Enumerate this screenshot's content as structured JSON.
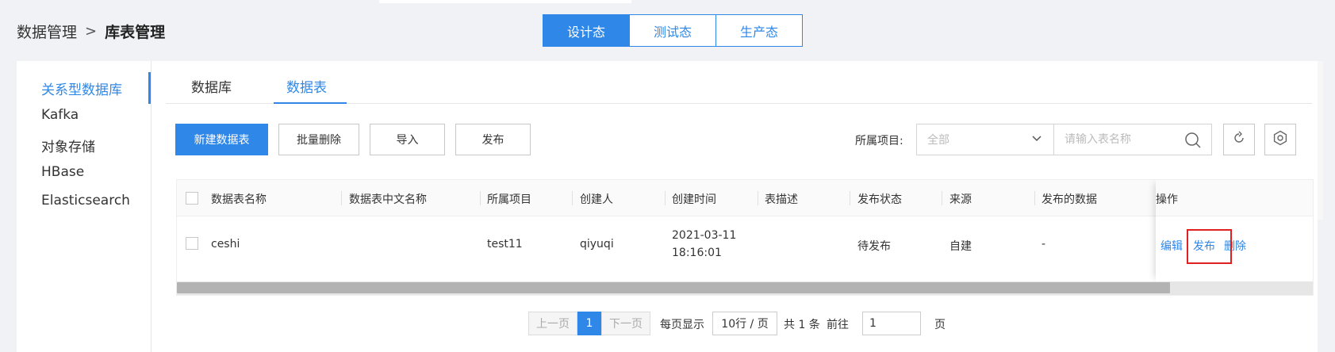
{
  "breadcrumb": {
    "parent": "数据管理",
    "separator": ">",
    "current": "库表管理"
  },
  "env_tabs": [
    {
      "label": "设计态",
      "active": true
    },
    {
      "label": "测试态",
      "active": false
    },
    {
      "label": "生产态",
      "active": false
    }
  ],
  "sidebar": {
    "items": [
      {
        "label": "关系型数据库",
        "active": true
      },
      {
        "label": "Kafka",
        "active": false
      },
      {
        "label": "对象存储",
        "active": false
      },
      {
        "label": "HBase",
        "active": false
      },
      {
        "label": "Elasticsearch",
        "active": false
      }
    ]
  },
  "sub_tabs": [
    {
      "label": "数据库",
      "active": false
    },
    {
      "label": "数据表",
      "active": true
    }
  ],
  "toolbar": {
    "new_table": "新建数据表",
    "batch_delete": "批量删除",
    "import": "导入",
    "publish": "发布",
    "project_label": "所属项目:",
    "project_value": "全部",
    "search_placeholder": "请输入表名称",
    "refresh_icon": "refresh-icon",
    "settings_icon": "gear-icon"
  },
  "table": {
    "columns": [
      "数据表名称",
      "数据表中文名称",
      "所属项目",
      "创建人",
      "创建时间",
      "表描述",
      "发布状态",
      "来源",
      "发布的数据",
      "操作"
    ],
    "rows": [
      {
        "name": "ceshi",
        "cn_name": "",
        "project": "test11",
        "creator": "qiyuqi",
        "created_date": "2021-03-11",
        "created_time": "18:16:01",
        "description": "",
        "status": "待发布",
        "source": "自建",
        "published": "-",
        "actions": [
          "编辑",
          "发布",
          "删除"
        ]
      }
    ]
  },
  "pagination": {
    "prev": "上一页",
    "page": "1",
    "next": "下一页",
    "per_page_label": "每页显示",
    "per_page_value": "10行 / 页",
    "total": "共 1 条",
    "goto_label": "前往",
    "goto_value": "1",
    "page_suffix": "页"
  },
  "colors": {
    "accent": "#2f87e8",
    "highlight": "#e02020"
  }
}
